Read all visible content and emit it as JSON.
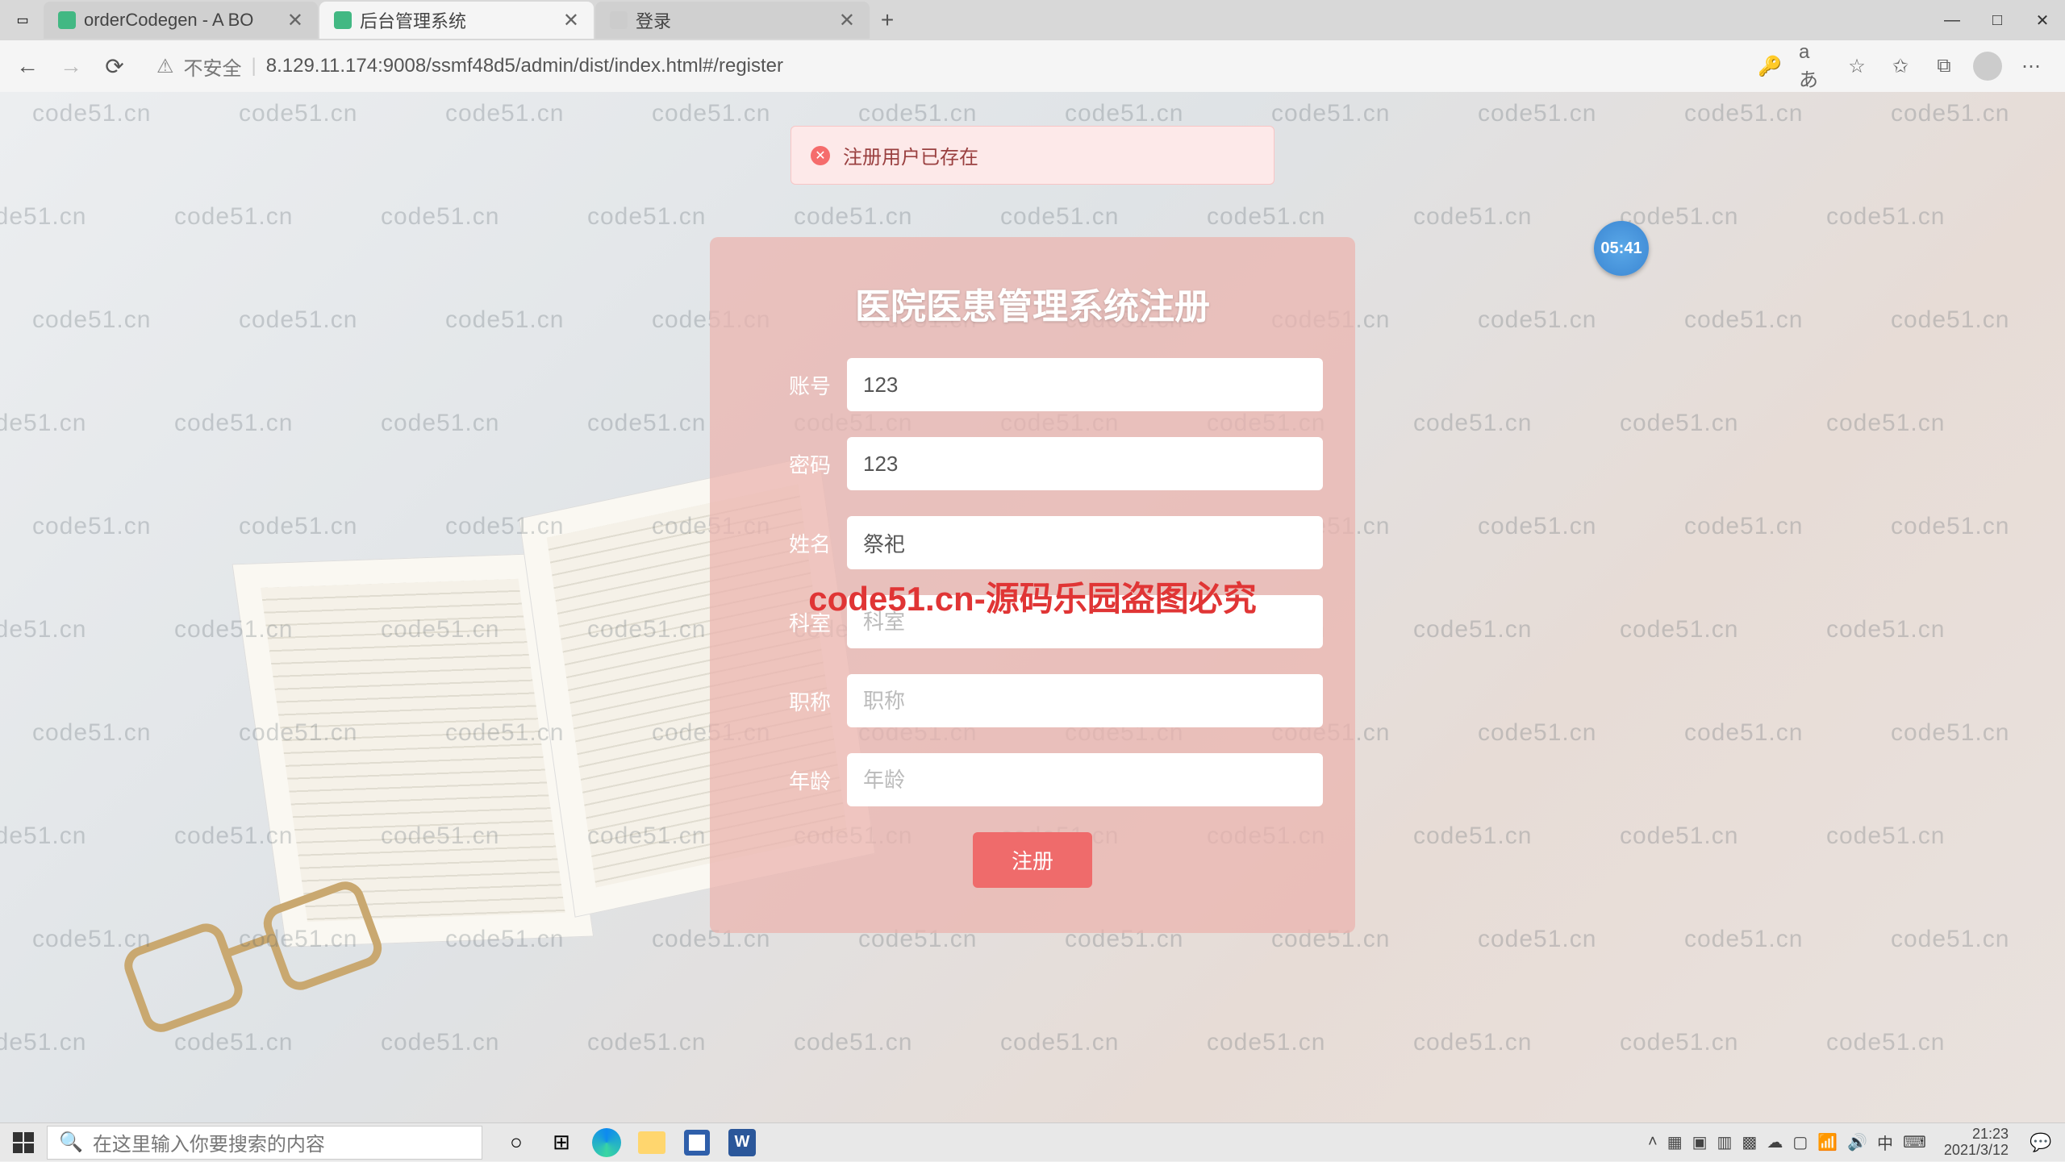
{
  "tabs": [
    {
      "label": "orderCodegen - A BO"
    },
    {
      "label": "后台管理系统"
    },
    {
      "label": "登录"
    }
  ],
  "window_controls": {
    "min": "—",
    "max": "□",
    "close": "✕"
  },
  "address": {
    "security_label": "不安全",
    "url": "8.129.11.174:9008/ssmf48d5/admin/dist/index.html#/register"
  },
  "toast": {
    "message": "注册用户已存在"
  },
  "card": {
    "title": "医院医患管理系统注册",
    "fields": {
      "account": {
        "label": "账号",
        "value": "123"
      },
      "password": {
        "label": "密码",
        "value": "123"
      },
      "name": {
        "label": "姓名",
        "value": "祭祀"
      },
      "dept": {
        "label": "科室",
        "placeholder": "科室",
        "value": ""
      },
      "title": {
        "label": "职称",
        "placeholder": "职称",
        "value": ""
      },
      "age": {
        "label": "年龄",
        "placeholder": "年龄",
        "value": ""
      }
    },
    "submit": "注册"
  },
  "watermark_text": "code51.cn",
  "center_watermark": "code51.cn-源码乐园盗图必究",
  "clock_badge": "05:41",
  "taskbar": {
    "search_placeholder": "在这里输入你要搜索的内容",
    "time": "21:23",
    "date": "2021/3/12",
    "ime": "中"
  }
}
